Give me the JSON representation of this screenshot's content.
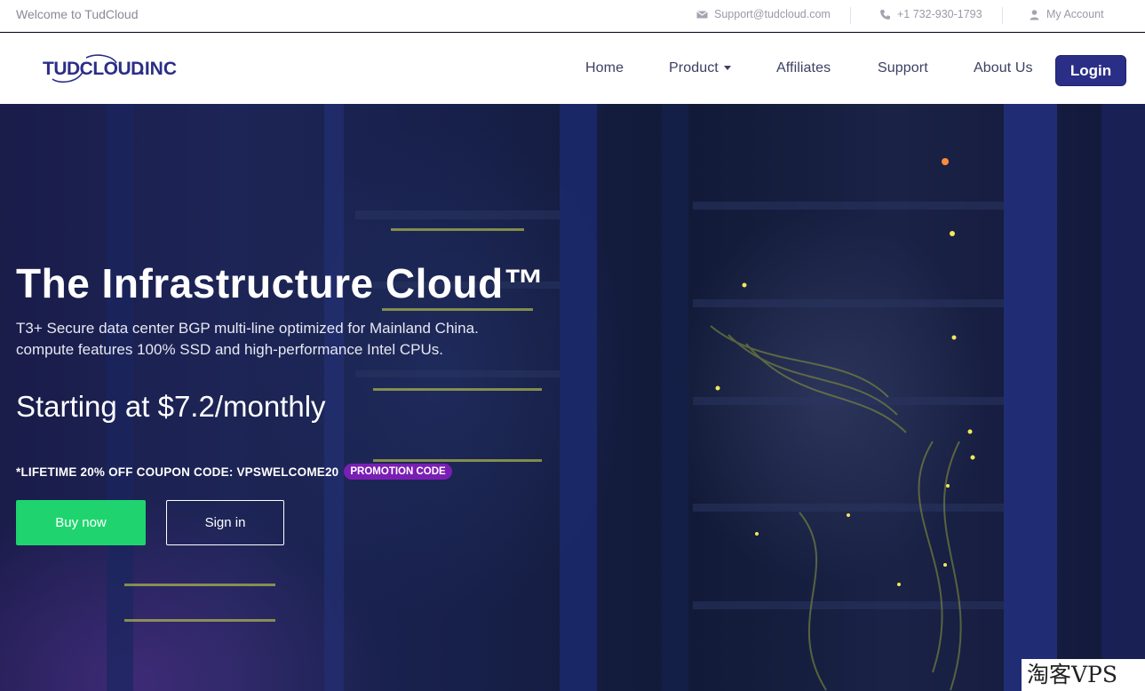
{
  "topbar": {
    "welcome": "Welcome to TudCloud",
    "email": "Support@tudcloud.com",
    "phone": "+1 732-930-1793",
    "account": "My Account"
  },
  "nav": {
    "logo_text": "TUDCLOUD.INC",
    "items": [
      {
        "label": "Home"
      },
      {
        "label": "Product"
      },
      {
        "label": "Affiliates"
      },
      {
        "label": "Support"
      },
      {
        "label": "About Us"
      }
    ],
    "login": "Login"
  },
  "hero": {
    "title": "The Infrastructure Cloud™",
    "subtitle_line1": "T3+ Secure data center BGP multi-line optimized for Mainland China.",
    "subtitle_line2": "compute features 100% SSD and high-performance Intel CPUs.",
    "price": "Starting at $7.2/monthly",
    "coupon_text": "*LIFETIME 20% OFF COUPON CODE: VPSWELCOME20",
    "coupon_badge": "PROMOTION CODE",
    "buy_button": "Buy now",
    "signin_button": "Sign in"
  },
  "watermark": "淘客VPS",
  "colors": {
    "nav_text": "#3b3f63",
    "login_bg": "#2b2e86",
    "buy_bg": "#1fd46e",
    "badge_bg": "#7a1fb3"
  }
}
